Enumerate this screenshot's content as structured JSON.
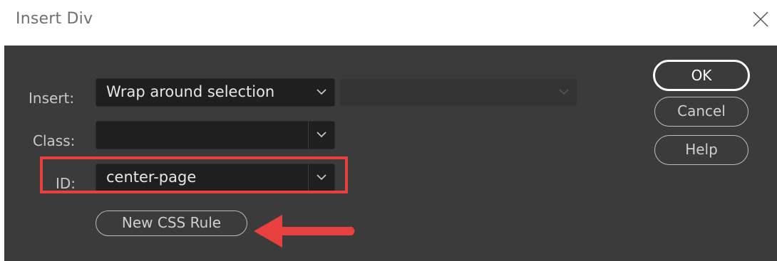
{
  "dialog": {
    "title": "Insert Div"
  },
  "form": {
    "insert": {
      "label": "Insert:",
      "value": "Wrap around selection",
      "secondary_value": ""
    },
    "class": {
      "label": "Class:",
      "value": ""
    },
    "id": {
      "label": "ID:",
      "value": "center-page"
    },
    "new_css_rule_label": "New CSS Rule"
  },
  "buttons": {
    "ok_label": "OK",
    "cancel_label": "Cancel",
    "help_label": "Help"
  },
  "annotations": {
    "highlight_color": "#e8403e",
    "arrow_color": "#e8403e"
  },
  "icons": {
    "close": "close-icon",
    "dropdown": "chevron-down-icon",
    "annotation_arrow": "arrow-left-icon"
  }
}
